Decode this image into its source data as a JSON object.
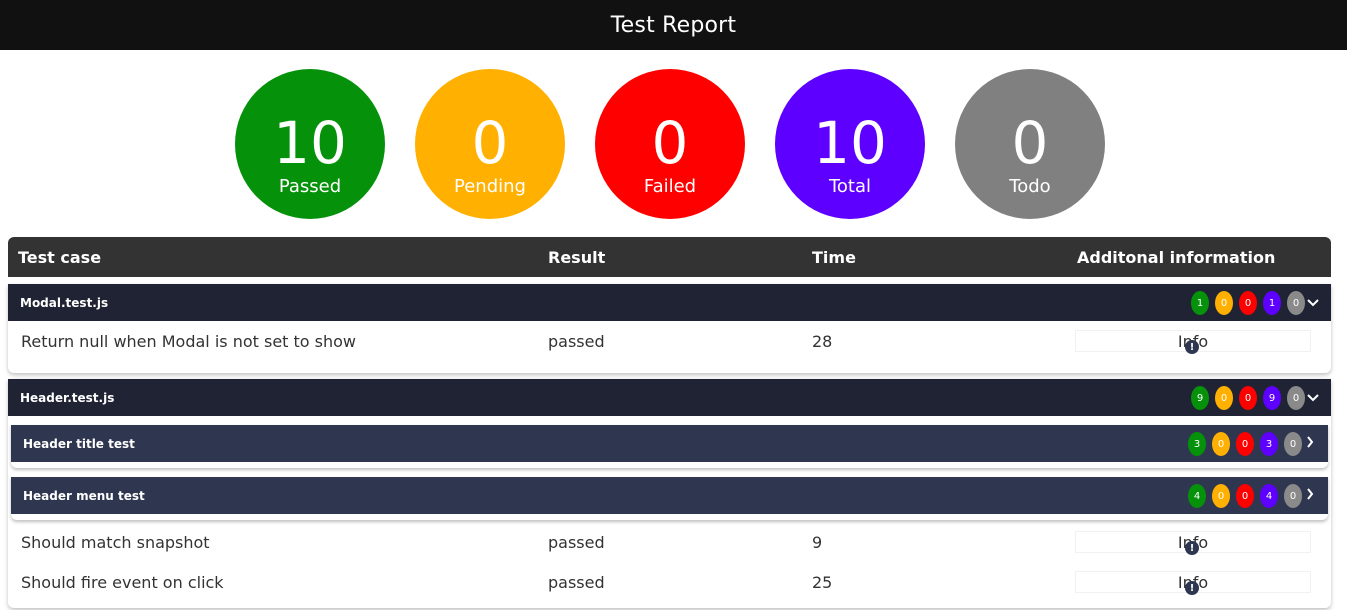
{
  "header": {
    "title": "Test Report"
  },
  "summary": [
    {
      "key": "passed",
      "value": "10",
      "label": "Passed",
      "color": "#05920a"
    },
    {
      "key": "pending",
      "value": "0",
      "label": "Pending",
      "color": "#ffb000"
    },
    {
      "key": "failed",
      "value": "0",
      "label": "Failed",
      "color": "#ff0000"
    },
    {
      "key": "total",
      "value": "10",
      "label": "Total",
      "color": "#5e00ff"
    },
    {
      "key": "todo",
      "value": "0",
      "label": "Todo",
      "color": "#808080"
    }
  ],
  "table": {
    "headers": [
      "Test case",
      "Result",
      "Time",
      "Additonal information"
    ]
  },
  "groups": [
    {
      "name": "Modal.test.js",
      "counts": [
        "1",
        "0",
        "0",
        "1",
        "0"
      ],
      "rows": [
        {
          "name": "Return null when Modal is not set to show",
          "result": "passed",
          "time": "28",
          "info": "Info"
        }
      ]
    },
    {
      "name": "Header.test.js",
      "counts": [
        "9",
        "0",
        "0",
        "9",
        "0"
      ],
      "subgroups": [
        {
          "name": "Header title test",
          "counts": [
            "3",
            "0",
            "0",
            "3",
            "0"
          ]
        },
        {
          "name": "Header menu test",
          "counts": [
            "4",
            "0",
            "0",
            "4",
            "0"
          ]
        }
      ],
      "rows": [
        {
          "name": "Should match snapshot",
          "result": "passed",
          "time": "9",
          "info": "Info"
        },
        {
          "name": "Should fire event on click",
          "result": "passed",
          "time": "25",
          "info": "Info"
        }
      ]
    }
  ],
  "icons": {
    "expanded": "chevron-down-icon",
    "collapsed": "chevron-right-icon",
    "info": "info-circle-icon"
  }
}
